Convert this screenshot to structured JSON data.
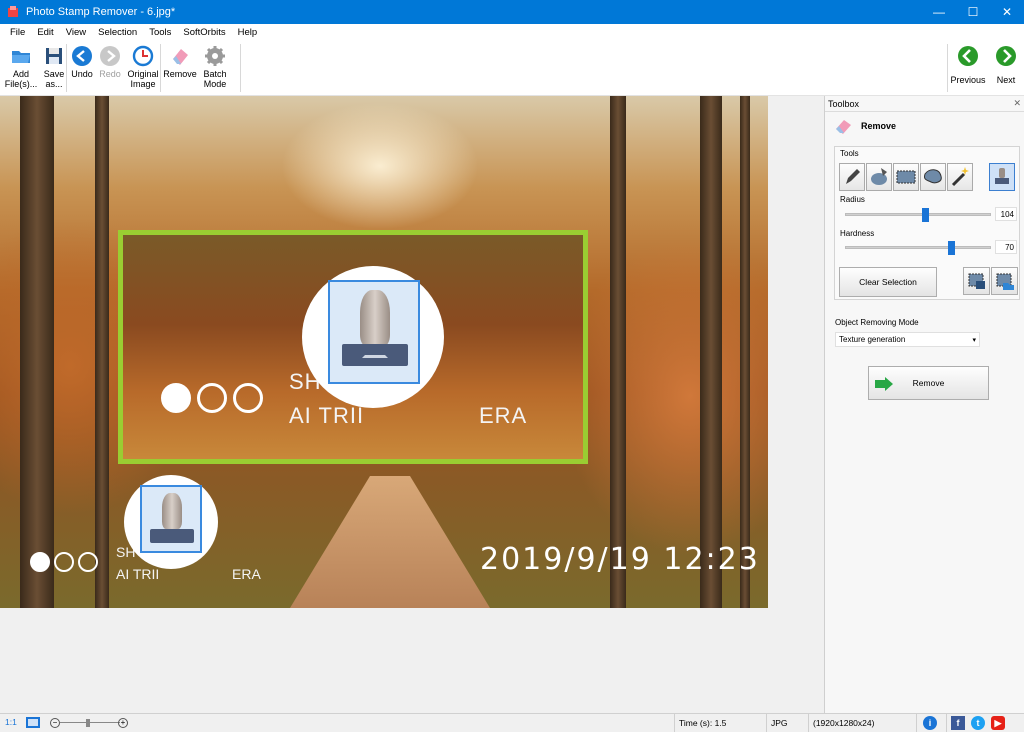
{
  "window": {
    "title": "Photo Stamp Remover - 6.jpg*",
    "controls": {
      "minimize": "—",
      "maximize": "☐",
      "close": "✕"
    }
  },
  "menu": [
    "File",
    "Edit",
    "View",
    "Selection",
    "Tools",
    "SoftOrbits",
    "Help"
  ],
  "toolbar": {
    "add_files": "Add\nFile(s)...",
    "save_as": "Save\nas...",
    "undo": "Undo",
    "redo": "Redo",
    "original_image": "Original\nImage",
    "remove": "Remove",
    "batch_mode": "Batch\nMode",
    "previous": "Previous",
    "next": "Next"
  },
  "photo": {
    "overlay_top": "SH",
    "overlay_bottom": "AI TRII",
    "overlay_suffix": "ERA",
    "small_top": "SH",
    "small_bottom": "AI TRII",
    "small_suffix": "ERA",
    "datestamp": "2019/9/19  12:23"
  },
  "toolbox": {
    "title": "Toolbox",
    "close": "✕",
    "section": "Remove",
    "tools_label": "Tools",
    "radius_label": "Radius",
    "radius_value": "104",
    "radius_fraction": 0.52,
    "hardness_label": "Hardness",
    "hardness_value": "70",
    "hardness_fraction": 0.7,
    "clear_selection": "Clear Selection",
    "mode_label": "Object Removing Mode",
    "mode_value": "Texture generation",
    "remove_button": "Remove"
  },
  "statusbar": {
    "zoom": "1:1",
    "time": "Time (s): 1.5",
    "format": "JPG",
    "dimensions": "(1920x1280x24)"
  },
  "colors": {
    "titlebar": "#0078d7",
    "selection": "#9acd32",
    "accent": "#1a74d6"
  }
}
